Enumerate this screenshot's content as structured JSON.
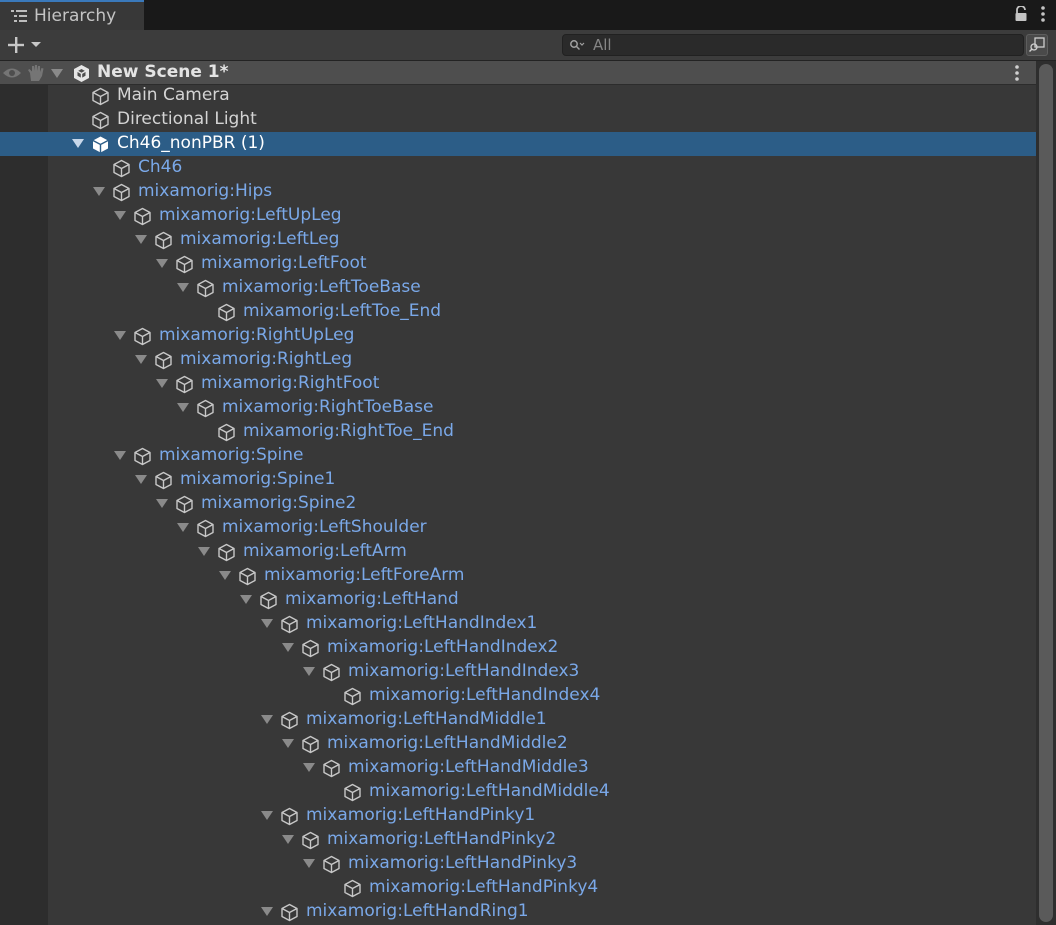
{
  "window": {
    "tab_label": "Hierarchy"
  },
  "toolbar": {
    "search_placeholder": "All"
  },
  "scene": {
    "name": "New Scene 1*"
  },
  "rows": [
    {
      "label": "Main Camera",
      "depth": 0,
      "expanded": false,
      "kind": "go"
    },
    {
      "label": "Directional Light",
      "depth": 0,
      "expanded": false,
      "kind": "go"
    },
    {
      "label": "Ch46_nonPBR (1)",
      "depth": 0,
      "expanded": true,
      "kind": "prefab-root",
      "selected": true
    },
    {
      "label": "Ch46",
      "depth": 1,
      "expanded": false,
      "kind": "prefab"
    },
    {
      "label": "mixamorig:Hips",
      "depth": 1,
      "expanded": true,
      "kind": "prefab"
    },
    {
      "label": "mixamorig:LeftUpLeg",
      "depth": 2,
      "expanded": true,
      "kind": "prefab"
    },
    {
      "label": "mixamorig:LeftLeg",
      "depth": 3,
      "expanded": true,
      "kind": "prefab"
    },
    {
      "label": "mixamorig:LeftFoot",
      "depth": 4,
      "expanded": true,
      "kind": "prefab"
    },
    {
      "label": "mixamorig:LeftToeBase",
      "depth": 5,
      "expanded": true,
      "kind": "prefab"
    },
    {
      "label": "mixamorig:LeftToe_End",
      "depth": 6,
      "expanded": false,
      "kind": "prefab"
    },
    {
      "label": "mixamorig:RightUpLeg",
      "depth": 2,
      "expanded": true,
      "kind": "prefab"
    },
    {
      "label": "mixamorig:RightLeg",
      "depth": 3,
      "expanded": true,
      "kind": "prefab"
    },
    {
      "label": "mixamorig:RightFoot",
      "depth": 4,
      "expanded": true,
      "kind": "prefab"
    },
    {
      "label": "mixamorig:RightToeBase",
      "depth": 5,
      "expanded": true,
      "kind": "prefab"
    },
    {
      "label": "mixamorig:RightToe_End",
      "depth": 6,
      "expanded": false,
      "kind": "prefab"
    },
    {
      "label": "mixamorig:Spine",
      "depth": 2,
      "expanded": true,
      "kind": "prefab"
    },
    {
      "label": "mixamorig:Spine1",
      "depth": 3,
      "expanded": true,
      "kind": "prefab"
    },
    {
      "label": "mixamorig:Spine2",
      "depth": 4,
      "expanded": true,
      "kind": "prefab"
    },
    {
      "label": "mixamorig:LeftShoulder",
      "depth": 5,
      "expanded": true,
      "kind": "prefab"
    },
    {
      "label": "mixamorig:LeftArm",
      "depth": 6,
      "expanded": true,
      "kind": "prefab"
    },
    {
      "label": "mixamorig:LeftForeArm",
      "depth": 7,
      "expanded": true,
      "kind": "prefab"
    },
    {
      "label": "mixamorig:LeftHand",
      "depth": 8,
      "expanded": true,
      "kind": "prefab"
    },
    {
      "label": "mixamorig:LeftHandIndex1",
      "depth": 9,
      "expanded": true,
      "kind": "prefab"
    },
    {
      "label": "mixamorig:LeftHandIndex2",
      "depth": 10,
      "expanded": true,
      "kind": "prefab"
    },
    {
      "label": "mixamorig:LeftHandIndex3",
      "depth": 11,
      "expanded": true,
      "kind": "prefab"
    },
    {
      "label": "mixamorig:LeftHandIndex4",
      "depth": 12,
      "expanded": false,
      "kind": "prefab"
    },
    {
      "label": "mixamorig:LeftHandMiddle1",
      "depth": 9,
      "expanded": true,
      "kind": "prefab"
    },
    {
      "label": "mixamorig:LeftHandMiddle2",
      "depth": 10,
      "expanded": true,
      "kind": "prefab"
    },
    {
      "label": "mixamorig:LeftHandMiddle3",
      "depth": 11,
      "expanded": true,
      "kind": "prefab"
    },
    {
      "label": "mixamorig:LeftHandMiddle4",
      "depth": 12,
      "expanded": false,
      "kind": "prefab"
    },
    {
      "label": "mixamorig:LeftHandPinky1",
      "depth": 9,
      "expanded": true,
      "kind": "prefab"
    },
    {
      "label": "mixamorig:LeftHandPinky2",
      "depth": 10,
      "expanded": true,
      "kind": "prefab"
    },
    {
      "label": "mixamorig:LeftHandPinky3",
      "depth": 11,
      "expanded": true,
      "kind": "prefab"
    },
    {
      "label": "mixamorig:LeftHandPinky4",
      "depth": 12,
      "expanded": false,
      "kind": "prefab"
    },
    {
      "label": "mixamorig:LeftHandRing1",
      "depth": 9,
      "expanded": true,
      "kind": "prefab"
    }
  ]
}
